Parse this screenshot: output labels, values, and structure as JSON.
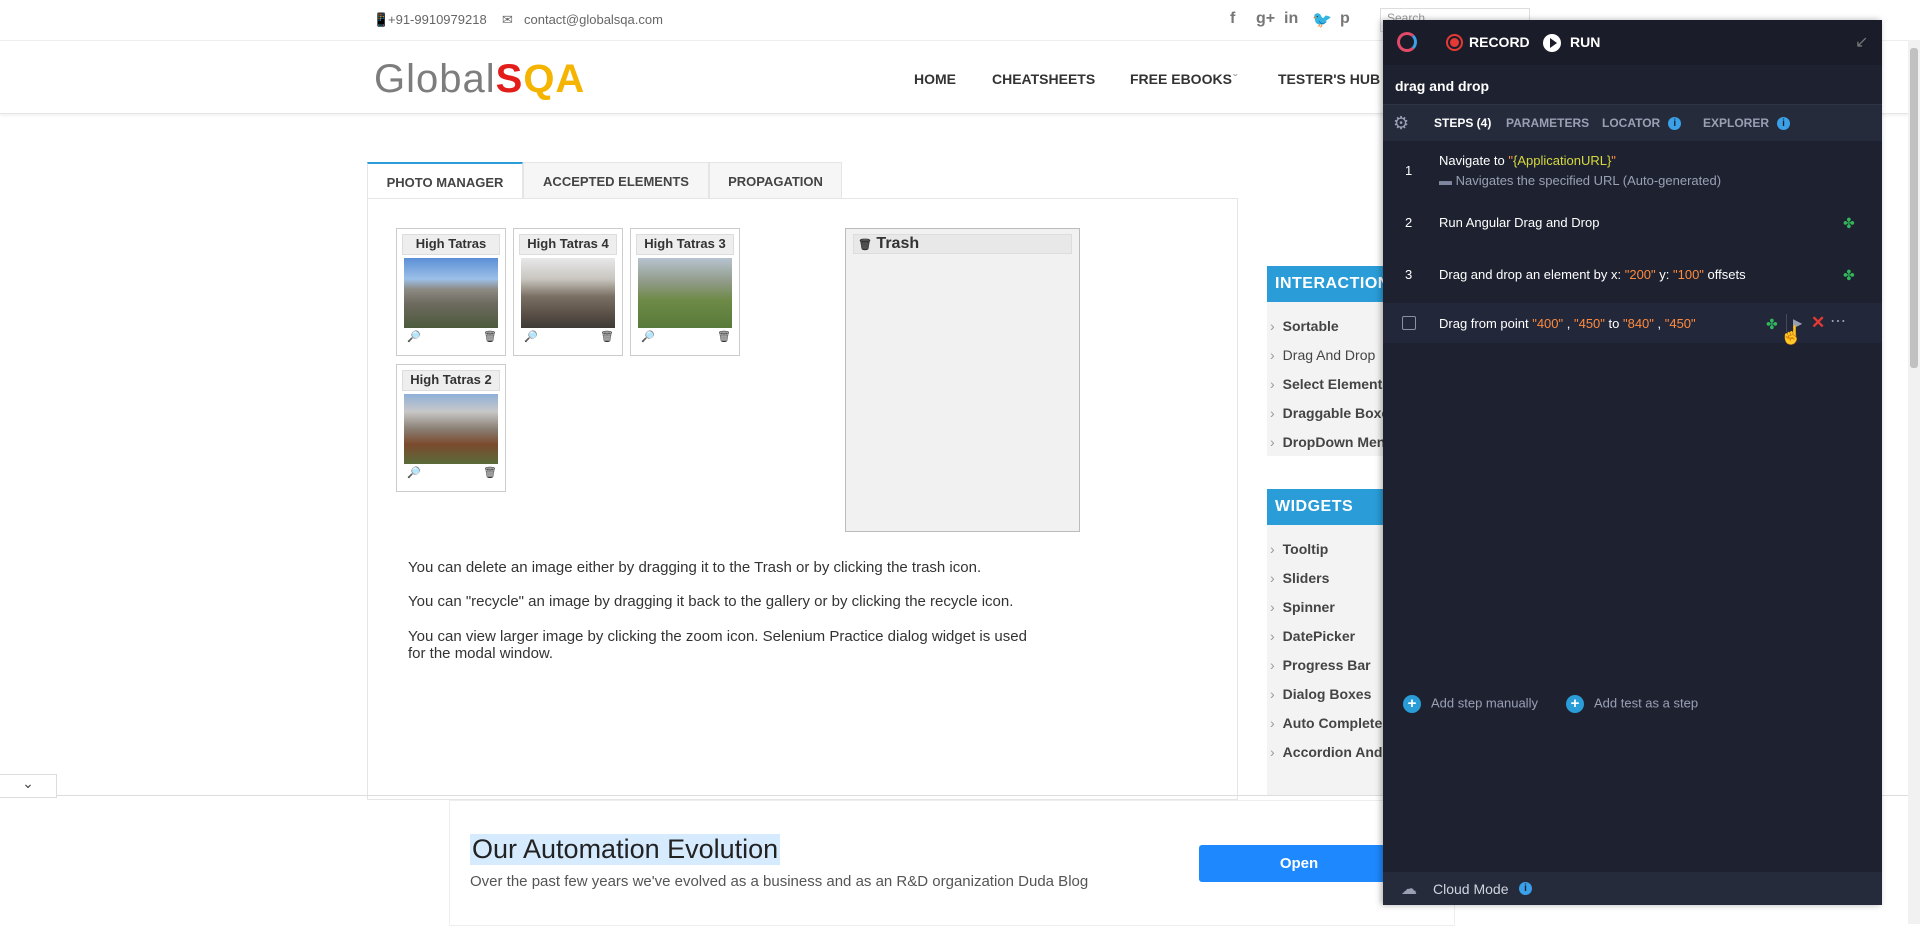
{
  "topbar": {
    "phone": "+91-9910979218",
    "email": "contact@globalsqa.com",
    "social_icons": [
      "facebook-icon",
      "google-plus-icon",
      "linkedin-icon",
      "twitter-icon",
      "pinterest-icon"
    ],
    "search_placeholder": "Search..."
  },
  "logo": {
    "part1": "Global",
    "part2": "S",
    "part3": "QA"
  },
  "nav": {
    "items": [
      "HOME",
      "CHEATSHEETS",
      "FREE EBOOKS",
      "TESTER'S HUB"
    ],
    "dropdown_mark": "ˇ"
  },
  "tabs": [
    "PHOTO MANAGER",
    "ACCEPTED ELEMENTS",
    "PROPAGATION"
  ],
  "gallery": {
    "photos": [
      "High Tatras",
      "High Tatras 4",
      "High Tatras 3",
      "High Tatras 2"
    ],
    "zoom_glyph": "🔎",
    "delete_glyph": "🗑"
  },
  "trash": {
    "title": "Trash",
    "icon": "trash-icon"
  },
  "description": [
    "You can delete an image either by dragging it to the Trash or by clicking the trash icon.",
    "You can \"recycle\" an image by dragging it back to the gallery or by clicking the recycle icon.",
    "You can view larger image by clicking the zoom icon. Selenium Practice dialog widget is used for the modal window."
  ],
  "sidebar": {
    "interactions_title": "INTERACTIONS",
    "interactions": [
      "Sortable",
      "Drag And Drop",
      "Select Elements",
      "Draggable Boxes",
      "DropDown Menu"
    ],
    "widgets_title": "WIDGETS",
    "widgets": [
      "Tooltip",
      "Sliders",
      "Spinner",
      "DatePicker",
      "Progress Bar",
      "Dialog Boxes",
      "Auto Complete",
      "Accordion And Tabs"
    ]
  },
  "ad": {
    "title": "Our Automation Evolution",
    "subtitle": "Over the past few years we've evolved as a business and as an R&D organization Duda Blog",
    "button": "Open",
    "toggle_glyph": "⌄"
  },
  "extension": {
    "record_label": "RECORD",
    "run_label": "RUN",
    "test_title": "drag and drop",
    "tabs": {
      "steps": "STEPS (4)",
      "parameters": "PARAMETERS",
      "locator": "LOCATOR",
      "explorer": "EXPLORER"
    },
    "steps": {
      "s1_num": "1",
      "s1_pre": "Navigate to ",
      "s1_q1": "\"",
      "s1_param": "{ApplicationURL}",
      "s1_q2": "\"",
      "s1_comment": "Navigates the specified URL (Auto-generated)",
      "s2_num": "2",
      "s2_text": "Run Angular Drag and Drop",
      "s3_num": "3",
      "s3_pre": "Drag and drop an element by x: ",
      "s3_x": "\"200\"",
      "s3_mid": " y: ",
      "s3_y": "\"100\"",
      "s3_post": " offsets",
      "s4_pre": "Drag from point ",
      "s4_a": "\"400\"",
      "s4_comma1": " , ",
      "s4_b": "\"450\"",
      "s4_to": " to ",
      "s4_c": "\"840\"",
      "s4_comma2": " , ",
      "s4_d": "\"450\""
    },
    "add_step": "Add step manually",
    "add_test": "Add test as a step",
    "cloud_mode": "Cloud Mode",
    "info_glyph": "i",
    "plus_glyph": "+"
  },
  "colors": {
    "accent_blue": "#2a9dd8",
    "panel_bg": "#1e2230",
    "param_orange": "#ff8a3d",
    "param_yellow": "#d6d93d",
    "puzzle_green": "#31b65c",
    "ad_button": "#1e88ff"
  }
}
